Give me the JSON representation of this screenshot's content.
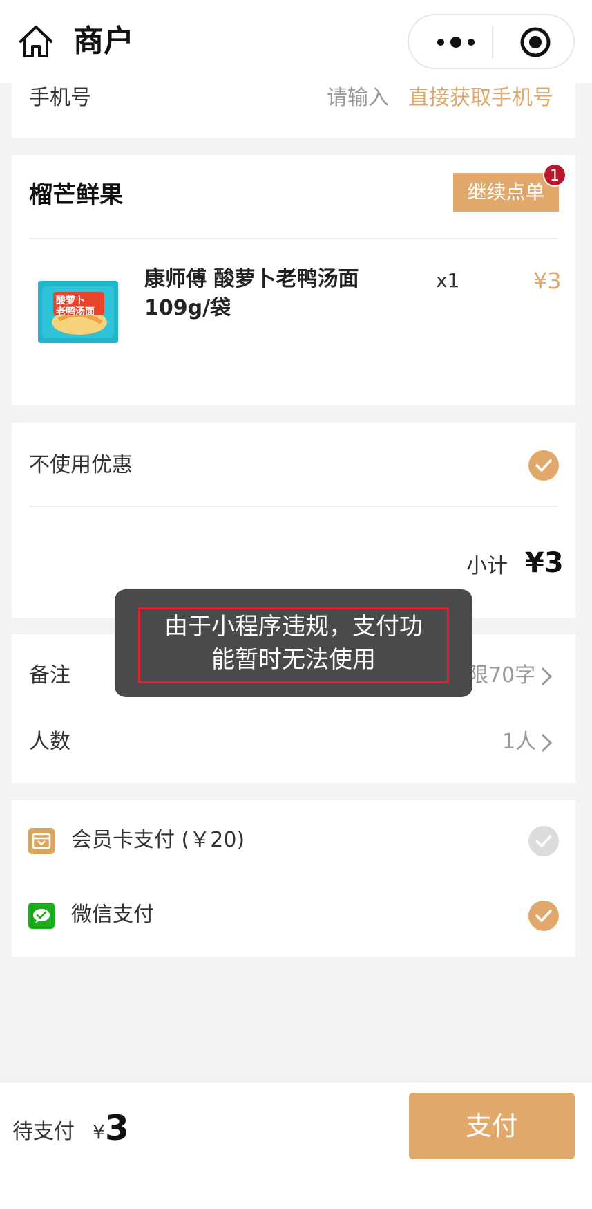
{
  "nav": {
    "title": "商户",
    "home_icon": "home-icon",
    "more_icon": "more-dots-icon",
    "close_icon": "target-circle-icon"
  },
  "phone": {
    "label": "手机号",
    "placeholder": "请输入",
    "get_phone_link": "直接获取手机号"
  },
  "store": {
    "name": "榴芒鲜果",
    "continue_label": "继续点单",
    "badge_count": "1",
    "item": {
      "name_line1": "康师傅 酸萝卜老鸭汤面",
      "name_line2": "109g/袋",
      "quantity": "x1",
      "price": "¥3",
      "package_text_line1": "酸萝卜",
      "package_text_line2": "老鸭汤面"
    }
  },
  "discount": {
    "label": "不使用优惠",
    "subtotal_label": "小计",
    "subtotal_value": "¥3"
  },
  "remarks": {
    "label": "备注",
    "value": "限70字",
    "people_label": "人数",
    "people_value": "1人"
  },
  "toast": {
    "line1": "由于小程序违规，支付功",
    "line2": "能暂时无法使用"
  },
  "payment": {
    "member_card_label": "会员卡支付 (￥20)",
    "wechat_label": "微信支付",
    "member_card_icon": "member-card-icon",
    "wechat_icon": "wechat-pay-icon"
  },
  "footer": {
    "pending_label": "待支付",
    "currency": "¥",
    "amount": "3",
    "pay_label": "支付"
  },
  "colors": {
    "accent": "#e0a96b",
    "badge": "#b8162a",
    "toast_bg": "#4a4a4a",
    "highlight_outline": "#e0202a",
    "wechat_green": "#1aad19"
  }
}
